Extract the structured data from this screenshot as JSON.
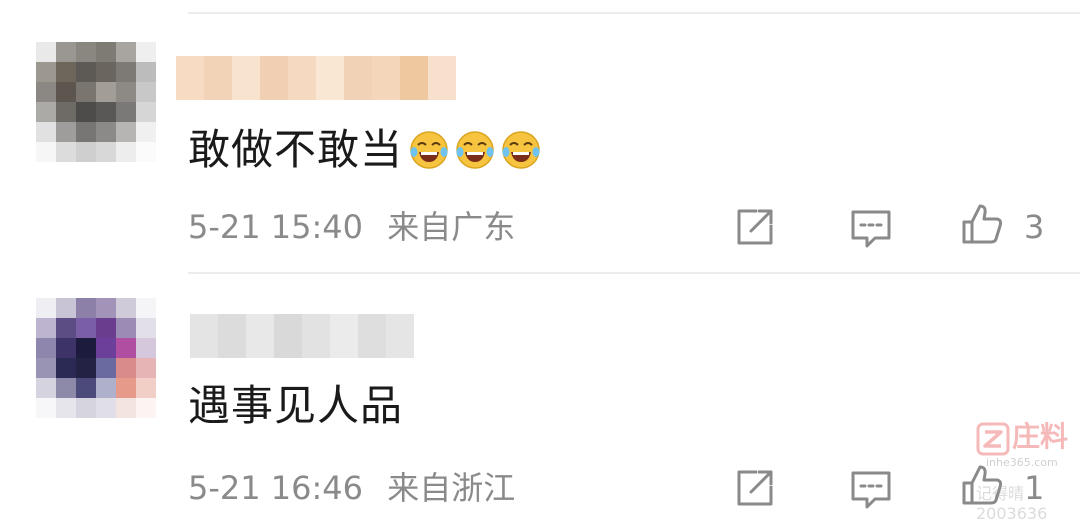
{
  "comments": [
    {
      "text": "敢做不敢当",
      "emoji_icon": "laugh-crying-emoji",
      "emoji_count": 3,
      "time": "5-21 15:40",
      "location": "来自广东",
      "like_count": "3",
      "avatar_colors": [
        "#e9e9e9",
        "#9a9691",
        "#8a8680",
        "#7e7a74",
        "#a8a49f",
        "#efefef",
        "#9c978f",
        "#6e655b",
        "#5d5a55",
        "#6a665f",
        "#7d7a75",
        "#bcbcbc",
        "#8b8782",
        "#5c564f",
        "#7a766f",
        "#a29d96",
        "#8d8a86",
        "#c8c8c8",
        "#acaaa7",
        "#6e6b67",
        "#4e4c4a",
        "#5a5856",
        "#7b7977",
        "#d6d6d6",
        "#e1e1e1",
        "#9f9d9b",
        "#787674",
        "#8c8a88",
        "#b7b5b3",
        "#f0f0f0",
        "#f6f6f6",
        "#dcdcdc",
        "#cfcfcf",
        "#d8d8d8",
        "#ededed",
        "#fbfbfb"
      ],
      "name_blur_colors": [
        "#f7dcc3",
        "#f3d3b8",
        "#f8e3ce",
        "#f1cfb2",
        "#f5dac1",
        "#f9e6d3",
        "#f2d2b6",
        "#f4d6bb",
        "#f0c89f",
        "#f7e1cc"
      ]
    },
    {
      "text": "遇事见人品",
      "time": "5-21 16:46",
      "location": "来自浙江",
      "like_count": "1",
      "avatar_colors": [
        "#efeef2",
        "#c8c3d5",
        "#8d80a8",
        "#a293b8",
        "#cfcbd8",
        "#f5f5f7",
        "#bdb4cf",
        "#5d4d85",
        "#7b5fa6",
        "#6a3d8f",
        "#9b8cb6",
        "#e2dfe8",
        "#8f86ad",
        "#3e3368",
        "#1d1b3d",
        "#6c3f9a",
        "#b04fa2",
        "#d5c8dd",
        "#9993b4",
        "#2b2a55",
        "#232244",
        "#6a6aa0",
        "#d98b8b",
        "#e6b4b4",
        "#d6d3e0",
        "#8c8aa8",
        "#4b4a7a",
        "#aeb0cc",
        "#e59a8a",
        "#f2cfc6",
        "#f7f7f9",
        "#e6e5ec",
        "#d5d4df",
        "#e0dfe7",
        "#f3e4e0",
        "#fbf4f2"
      ],
      "name_blur_colors": [
        "#e4e4e4",
        "#dcdcdc",
        "#e8e8e8",
        "#d9d9d9",
        "#e2e2e2",
        "#ebebeb",
        "#dedede",
        "#e5e5e5"
      ]
    }
  ],
  "icons": {
    "share": "share-icon",
    "reply": "comment-icon",
    "like": "thumbs-up-icon"
  },
  "watermark": {
    "title": "庄料",
    "url": "inhe365.com",
    "extra": "记得晴 2003636"
  },
  "colors": {
    "text_primary": "#1a1a1a",
    "text_secondary": "#8a8a8a",
    "divider": "#ececec",
    "emoji_yellow": "#f6c43e",
    "watermark_red": "#e33a3a"
  }
}
